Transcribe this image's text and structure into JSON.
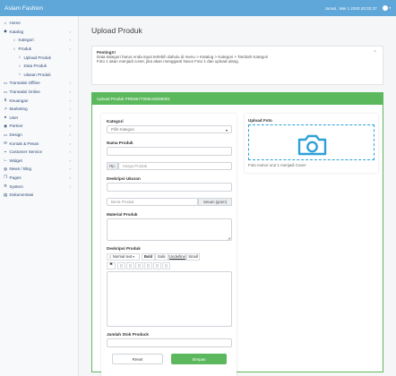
{
  "header": {
    "brand": "Aslam Fashion",
    "datetime": "Jumat , Mei 1 2020 20:32:37"
  },
  "sidebar": {
    "items": [
      {
        "label": "Home",
        "icon": "home-icon",
        "level": 0,
        "chev": false
      },
      {
        "label": "Katalog",
        "icon": "tag-icon",
        "level": 0,
        "chev": true
      },
      {
        "label": "Kategori",
        "icon": "circle-icon",
        "level": 1,
        "chev": true
      },
      {
        "label": "Produk",
        "icon": "circle-icon",
        "level": 1,
        "chev": true
      },
      {
        "label": "Upload Produk",
        "icon": "circle-icon",
        "level": 2,
        "chev": false
      },
      {
        "label": "Data Produk",
        "icon": "circle-icon",
        "level": 2,
        "chev": false
      },
      {
        "label": "Ulasan Produk",
        "icon": "circle-icon",
        "level": 2,
        "chev": false
      },
      {
        "label": "Transaksi Offline",
        "icon": "cart-icon",
        "level": 0,
        "chev": true
      },
      {
        "label": "Transaksi Online",
        "icon": "cart-icon",
        "level": 0,
        "chev": true
      },
      {
        "label": "Keuangan",
        "icon": "dollar-icon",
        "level": 0,
        "chev": true
      },
      {
        "label": "Marketing",
        "icon": "share-icon",
        "level": 0,
        "chev": true
      },
      {
        "label": "User",
        "icon": "user-icon",
        "level": 0,
        "chev": true
      },
      {
        "label": "Partner",
        "icon": "users-icon",
        "level": 0,
        "chev": true
      },
      {
        "label": "Design",
        "icon": "monitor-icon",
        "level": 0,
        "chev": true
      },
      {
        "label": "Kontak & Pesan",
        "icon": "mail-icon",
        "level": 0,
        "chev": true
      },
      {
        "label": "Customer Service",
        "icon": "chat-icon",
        "level": 0,
        "chev": true
      },
      {
        "label": "Widget",
        "icon": "chart-icon",
        "level": 0,
        "chev": true
      },
      {
        "label": "News / Blog",
        "icon": "globe-icon",
        "level": 0,
        "chev": true
      },
      {
        "label": "Pages",
        "icon": "copy-icon",
        "level": 0,
        "chev": true
      },
      {
        "label": "System",
        "icon": "cog-icon",
        "level": 0,
        "chev": true
      },
      {
        "label": "Dokumentasi",
        "icon": "book-icon",
        "level": 0,
        "chev": false
      }
    ]
  },
  "page": {
    "title": "Upload Produk"
  },
  "alert": {
    "heading": "Penting!!!",
    "line1": "Data kategori harus Anda input terlebih dahulu di menu > Katalog > Kategori > Tambah Kategori",
    "line2": "Foto 1 akan menjadi cover, jika akan mengganti harus Foto 1 dan upload ulang.",
    "close": "×"
  },
  "card": {
    "header": "Upload Produk PRD5577069ce5086001"
  },
  "form": {
    "kategori_label": "Kategori",
    "kategori_value": "Pilih Kategori",
    "nama_label": "Nama Produk",
    "nama_value": "",
    "harga_prefix": "Rp.",
    "harga_placeholder": "Harga Produk",
    "deskripsi_ukuran_label": "Deskripsi Ukuran",
    "deskripsi_ukuran_value": "",
    "berat_placeholder": "Berat Produk",
    "berat_suffix": "satuan (gram)",
    "material_label": "Material Produk",
    "material_value": "",
    "deskripsi_label": "Deskripsi Produk",
    "jumlah_label": "Jumlah Stok Produck",
    "jumlah_value": "",
    "reset": "Reset",
    "simpan": "Simpan"
  },
  "editor": {
    "style_select": "Normal text",
    "bold": "Bold",
    "italic": "Italic",
    "underline": "Underline",
    "small": "Small",
    "quote": "❝",
    "list_buttons": [
      "▯",
      "▯",
      "▯",
      "▯",
      "▯",
      "▯"
    ]
  },
  "upload": {
    "title": "Upload Foto",
    "caption": "Foto nomor urut 1 menjadi Cover"
  },
  "colors": {
    "topbar": "#5fa7d8",
    "accent_green": "#5cb85c",
    "camera_blue": "#2fa0d8"
  }
}
